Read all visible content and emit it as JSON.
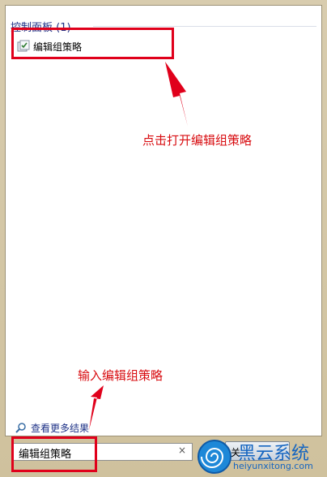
{
  "section": {
    "header": "控制面板 (1)"
  },
  "results": [
    {
      "label": "编辑组策略",
      "icon": "group-policy-icon"
    }
  ],
  "annotations": {
    "top": "点击打开编辑组策略",
    "bottom": "输入编辑组策略"
  },
  "see_more": {
    "label": "查看更多结果",
    "icon": "search-icon"
  },
  "search": {
    "value": "编辑组策略",
    "clear_icon": "×"
  },
  "shutdown": {
    "label": "关"
  },
  "watermark": {
    "brand": "黑云系统",
    "url": "heiyunxitong.com"
  },
  "colors": {
    "highlight": "#e0001b",
    "link": "#1e3287",
    "annotation": "#d80c10"
  }
}
